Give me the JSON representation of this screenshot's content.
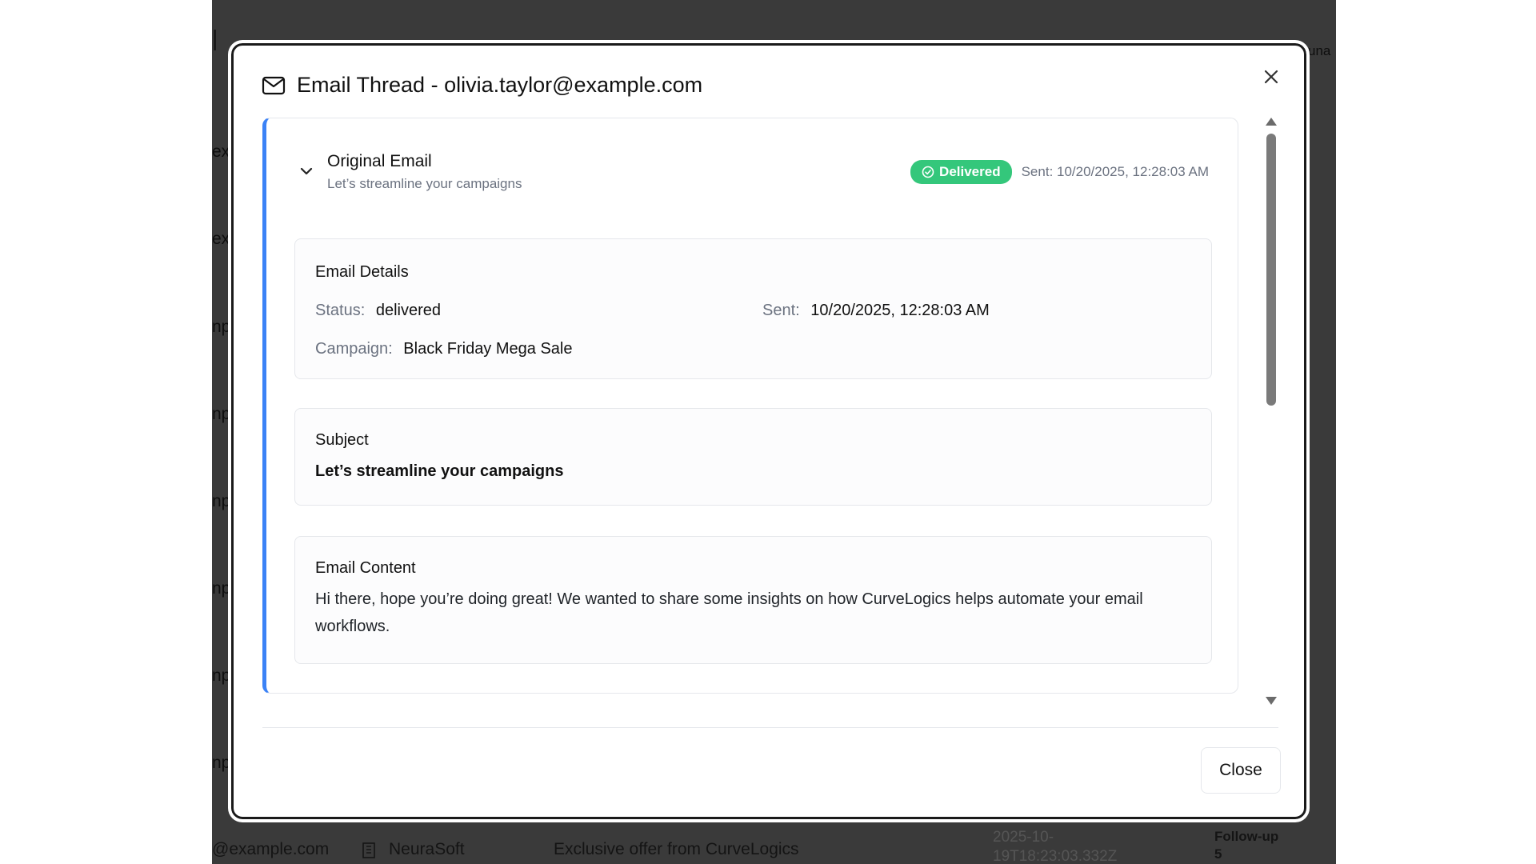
{
  "background": {
    "left_column_fragments": [
      "ex",
      "ex",
      "npl",
      "npl",
      "npl",
      "npl",
      "npl",
      "npl"
    ],
    "top_right_fragment": "una",
    "bottom_row": {
      "email": "@example.com",
      "company": "NeuraSoft",
      "subject": "Exclusive offer from CurveLogics",
      "date_line1": "2025-10-",
      "date_line2": "19T18:23:03.332Z",
      "stage_line1": "Follow-up",
      "stage_line2": "5"
    }
  },
  "modal": {
    "title": "Email Thread - olivia.taylor@example.com",
    "mail_icon": "mail-icon",
    "close_icon": "close-icon",
    "close_button": "Close"
  },
  "thread": {
    "accent_color": "#3b82f6",
    "original": {
      "title": "Original Email",
      "subtitle": "Let’s streamline your campaigns",
      "badge": "Delivered",
      "badge_color": "#34c77b",
      "sent": "Sent: 10/20/2025, 12:28:03 AM"
    },
    "details": {
      "heading": "Email Details",
      "status_label": "Status:",
      "status_value": "delivered",
      "sent_label": "Sent:",
      "sent_value": "10/20/2025, 12:28:03 AM",
      "campaign_label": "Campaign:",
      "campaign_value": "Black Friday Mega Sale"
    },
    "subject": {
      "heading": "Subject",
      "value": "Let’s streamline your campaigns"
    },
    "content": {
      "heading": "Email Content",
      "text": "Hi there, hope you’re doing great! We wanted to share some insights on how CurveLogics helps automate your email workflows."
    }
  }
}
